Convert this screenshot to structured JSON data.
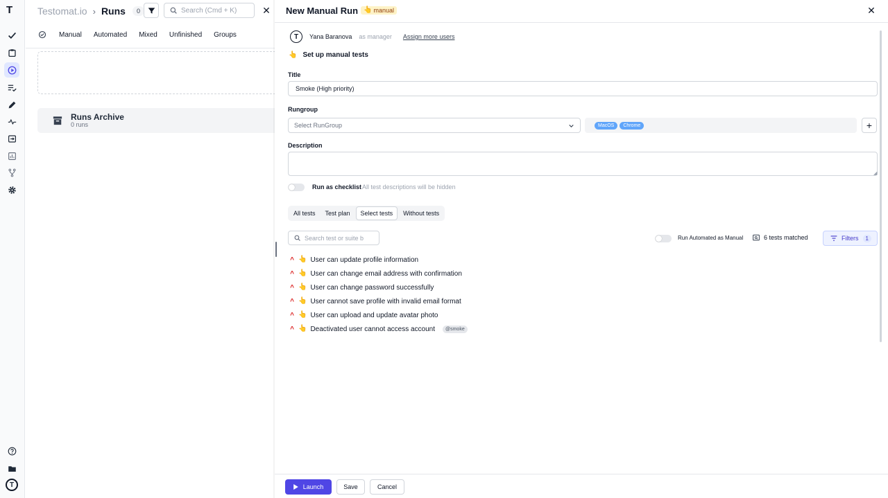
{
  "rail": {
    "logo": "T",
    "items": [
      {
        "name": "checkmark-icon"
      },
      {
        "name": "clipboard-icon"
      },
      {
        "name": "play-circle-icon",
        "active": true
      },
      {
        "name": "list-check-icon"
      },
      {
        "name": "pencil-icon"
      },
      {
        "name": "pulse-icon"
      },
      {
        "name": "import-icon"
      },
      {
        "name": "chart-icon"
      },
      {
        "name": "branch-icon"
      },
      {
        "name": "gear-icon"
      }
    ],
    "bottom": [
      {
        "name": "help-icon"
      },
      {
        "name": "folder-icon"
      },
      {
        "name": "user-avatar"
      }
    ]
  },
  "background": {
    "brand": "Testomat.io",
    "separator": "›",
    "section": "Runs",
    "count": "0",
    "search_placeholder": "Search (Cmd + K)",
    "tabs": [
      "Manual",
      "Automated",
      "Mixed",
      "Unfinished",
      "Groups"
    ],
    "archive": {
      "title": "Runs Archive",
      "subtitle": "0 runs"
    }
  },
  "panel": {
    "title": "New Manual Run",
    "badge": "manual",
    "manager": {
      "initial": "T",
      "name": "Yana Baranova",
      "role": "as manager",
      "assign_link": "Assign more users"
    },
    "setup_title": "Set up manual tests",
    "title_label": "Title",
    "title_value": "Smoke (High priority)",
    "rungroup_label": "Rungroup",
    "rungroup_placeholder": "Select RunGroup",
    "tags": [
      "MacOS",
      "Chrome"
    ],
    "description_label": "Description",
    "checklist_label": "Run as checklist",
    "checklist_hint": "All test descriptions will be hidden",
    "test_tabs": [
      {
        "label": "All tests"
      },
      {
        "label": "Test plan"
      },
      {
        "label": "Select tests",
        "active": true
      },
      {
        "label": "Without tests"
      }
    ],
    "test_search_placeholder": "Search test or suite b",
    "run_automated_label": "Run Automated as Manual",
    "matched": "6 tests matched",
    "filters_label": "Filters",
    "filters_count": "1",
    "tests": [
      {
        "title": "User can update profile information"
      },
      {
        "title": "User can change email address with confirmation"
      },
      {
        "title": "User can change password successfully"
      },
      {
        "title": "User cannot save profile with invalid email format"
      },
      {
        "title": "User can upload and update avatar photo"
      },
      {
        "title": "Deactivated user cannot access account",
        "tag": "@smoke"
      }
    ],
    "buttons": {
      "launch": "Launch",
      "save": "Save",
      "cancel": "Cancel"
    }
  },
  "colors": {
    "accent": "#4f46e5",
    "tag": "#60a5fa",
    "priority": "#dc2626"
  }
}
